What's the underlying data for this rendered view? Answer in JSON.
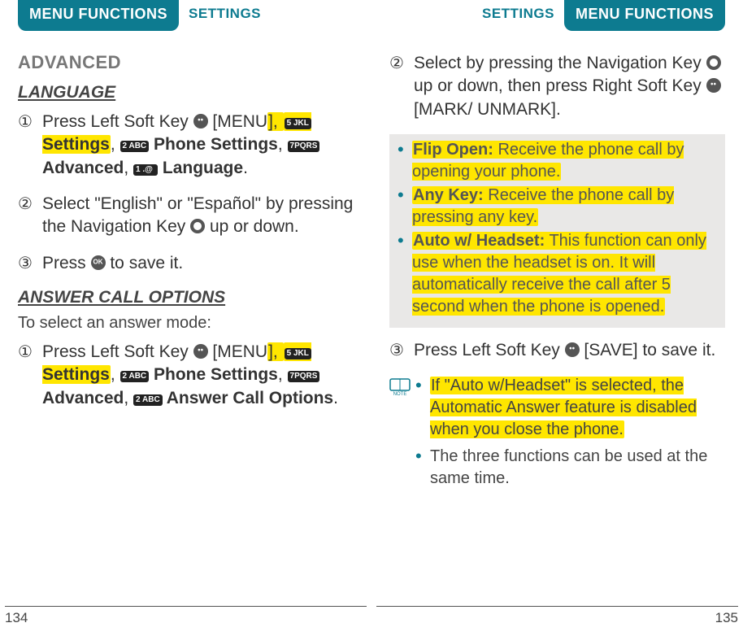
{
  "header": {
    "menu_functions": "MENU FUNCTIONS",
    "settings": "SETTINGS"
  },
  "left": {
    "title": "ADVANCED",
    "language_heading": "LANGUAGE",
    "lang_step1_a": "Press Left Soft Key ",
    "lang_step1_b": " [MENU",
    "lang_step1_c": "], ",
    "lang_step1_d": " Settings",
    "lang_step1_e": ", ",
    "lang_step1_f": " Phone Settings",
    "lang_step1_g": ", ",
    "lang_step1_h": " Advanced",
    "lang_step1_i": ", ",
    "lang_step1_j": " Language",
    "lang_step1_k": ".",
    "lang_step2": "Select \"English\" or \"Español\" by pressing the Navigation Key ",
    "lang_step2b": " up or down.",
    "lang_step3a": "Press ",
    "lang_step3b": " to save it.",
    "answer_heading": "ANSWER CALL OPTIONS",
    "answer_intro": "To select an answer mode:",
    "ans_step1_a": "Press Left Soft Key ",
    "ans_step1_b": " [MENU",
    "ans_step1_c": "], ",
    "ans_step1_d": " Settings",
    "ans_step1_e": ", ",
    "ans_step1_f": " Phone Settings",
    "ans_step1_g": ", ",
    "ans_step1_h": " Advanced",
    "ans_step1_i": ", ",
    "ans_step1_j": " Answer Call Options",
    "ans_step1_k": ".",
    "page_no": "134"
  },
  "right": {
    "step2a": "Select by pressing the Navigation Key ",
    "step2b": " up or down, then press Right Soft Key ",
    "step2c": " [MARK/ UNMARK].",
    "info1_label": "Flip Open:",
    "info1_text": " Receive the phone call by opening your phone.",
    "info2_label": "Any Key:",
    "info2_text": " Receive the phone call by pressing any key.",
    "info3_label": "Auto w/ Headset:",
    "info3_text": " This function can only use when the headset is on. It will automatically receive the call after 5 second when the phone is opened.",
    "step3a": "Press Left Soft Key ",
    "step3b": " [SAVE] to save it.",
    "note1": "If \"Auto w/Headset\" is selected, the Automatic Answer feature is disabled when you close the phone.",
    "note2": "The three functions can be used at the same time.",
    "page_no": "135"
  },
  "nums": {
    "one": "①",
    "two": "②",
    "three": "③"
  }
}
